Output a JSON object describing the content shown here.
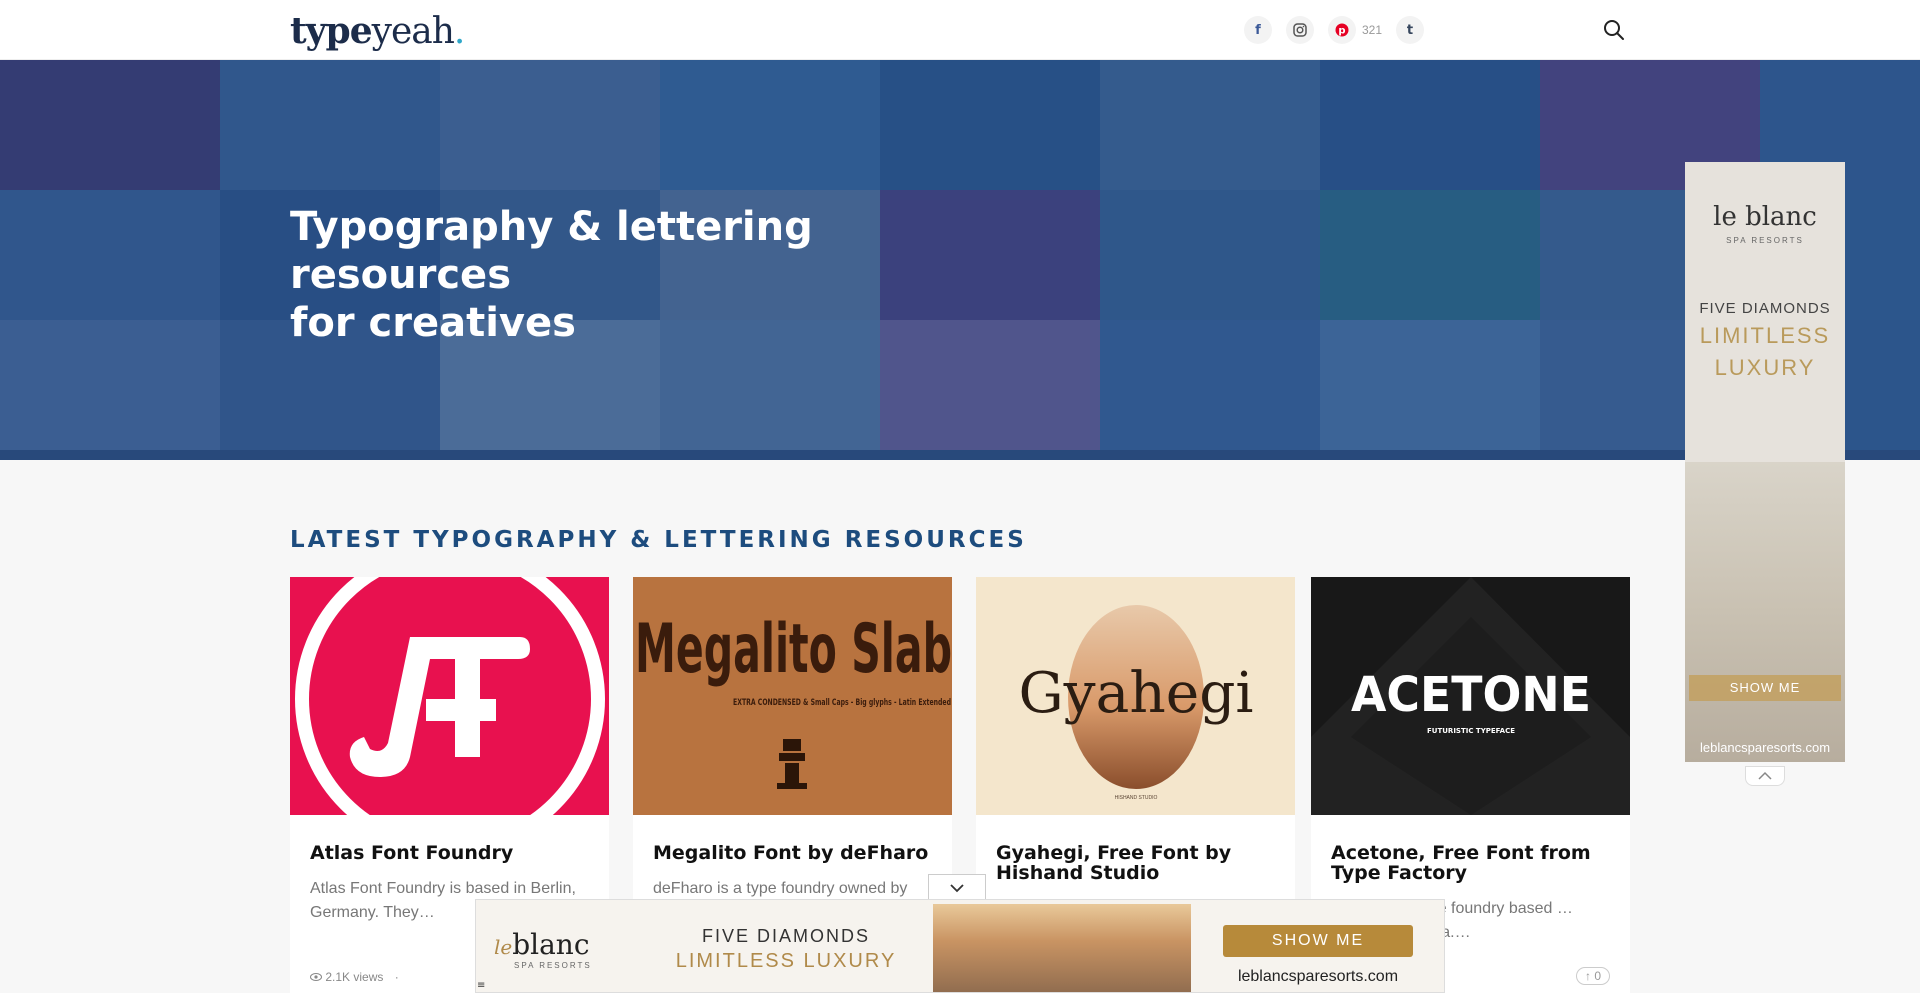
{
  "header": {
    "logo_type": "type",
    "logo_yeah": "yeah",
    "logo_dot": ".",
    "social": [
      {
        "name": "facebook-icon",
        "glyph": "f",
        "color": "#3b5998"
      },
      {
        "name": "instagram-icon",
        "glyph": "◎",
        "color": "#555555"
      },
      {
        "name": "pinterest-icon",
        "glyph": "P",
        "color": "#e60023"
      },
      {
        "name": "tumblr-icon",
        "glyph": "t",
        "color": "#36465d"
      }
    ],
    "pinterest_count": "321",
    "search_icon": "search-icon"
  },
  "hero": {
    "title_line1": "Typography & lettering resources",
    "title_line2": "for creatives"
  },
  "section": {
    "title": "LATEST TYPOGRAPHY & LETTERING RESOURCES"
  },
  "cards": [
    {
      "title": "Atlas Font Foundry",
      "excerpt": "Atlas Font Foundry is based in Berlin, Germany. They…",
      "views": "2.1K views",
      "sep": "·",
      "accent": "#e8114f"
    },
    {
      "title": "Megalito Font by deFharo",
      "excerpt": "deFharo is a type foundry owned by",
      "thumb_title": "Megalito Slab",
      "thumb_sub": "EXTRA CONDENSED & Small Caps - Big glyphs - Latin Extended",
      "accent": "#b8733f"
    },
    {
      "title": "Gyahegi, Free Font by Hishand Studio",
      "thumb_title": "Gyahegi",
      "thumb_sub": "HISHAND STUDIO",
      "accent": "#f4e6cc"
    },
    {
      "title": "Acetone, Free Font from Type Factory",
      "excerpt": "a type foundry based … onesia.…",
      "thumb_title": "ACETONE",
      "thumb_sub": "FUTURISTIC TYPEFACE",
      "votes": "0",
      "accent": "#181818"
    }
  ],
  "side_ad": {
    "brand": "le blanc",
    "brand_sub": "SPA RESORTS",
    "line1": "FIVE DIAMONDS",
    "line2": "LIMITLESS",
    "line3": "LUXURY",
    "button": "SHOW ME",
    "url": "leblancsparesorts.com"
  },
  "bottom_ad": {
    "brand_le": "le",
    "brand": "blanc",
    "brand_sub": "SPA RESORTS",
    "line1": "FIVE DIAMONDS",
    "line2": "LIMITLESS LUXURY",
    "button": "SHOW ME",
    "url": "leblancsparesorts.com"
  }
}
